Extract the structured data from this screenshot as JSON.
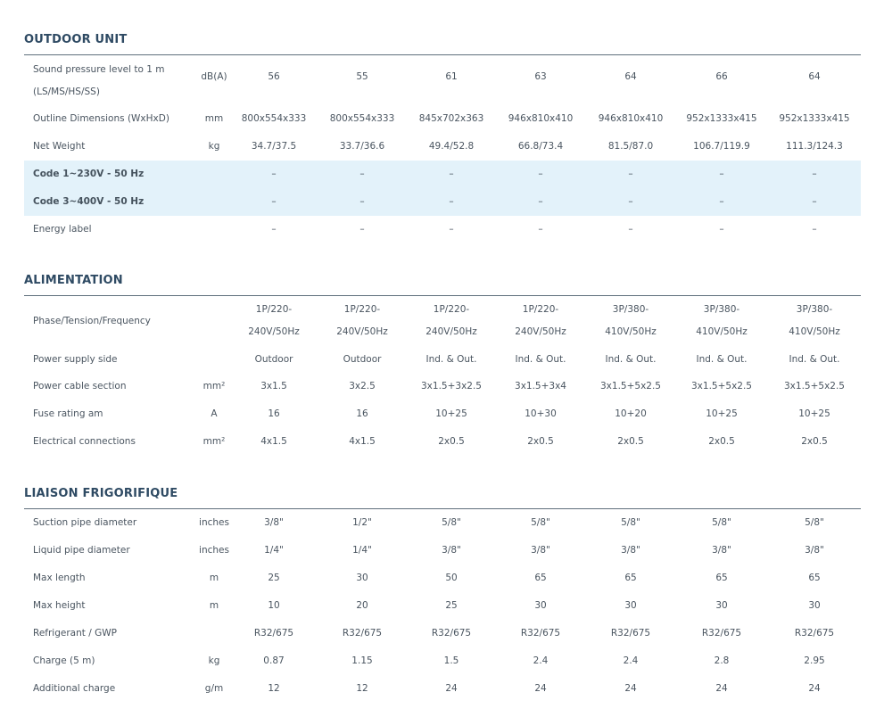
{
  "sections": [
    {
      "title": "OUTDOOR UNIT",
      "rows": [
        {
          "label": "Sound pressure level to 1 m (LS/MS/HS/SS)",
          "unit": "dB(A)",
          "values": [
            "56",
            "55",
            "61",
            "63",
            "64",
            "66",
            "64"
          ]
        },
        {
          "label": "Outline Dimensions (WxHxD)",
          "unit": "mm",
          "values": [
            "800x554x333",
            "800x554x333",
            "845x702x363",
            "946x810x410",
            "946x810x410",
            "952x1333x415",
            "952x1333x415"
          ]
        },
        {
          "label": "Net Weight",
          "unit": "kg",
          "values": [
            "34.7/37.5",
            "33.7/36.6",
            "49.4/52.8",
            "66.8/73.4",
            "81.5/87.0",
            "106.7/119.9",
            "111.3/124.3"
          ]
        },
        {
          "label": "Code 1~230V - 50 Hz",
          "unit": "",
          "values": [
            "–",
            "–",
            "–",
            "–",
            "–",
            "–",
            "–"
          ],
          "highlight": true
        },
        {
          "label": "Code 3~400V - 50 Hz",
          "unit": "",
          "values": [
            "–",
            "–",
            "–",
            "–",
            "–",
            "–",
            "–"
          ],
          "highlight": true
        },
        {
          "label": "Energy label",
          "unit": "",
          "values": [
            "–",
            "–",
            "–",
            "–",
            "–",
            "–",
            "–"
          ]
        }
      ]
    },
    {
      "title": "ALIMENTATION",
      "rows": [
        {
          "label": "Phase/Tension/Frequency",
          "unit": "",
          "values": [
            "1P/220-240V/50Hz",
            "1P/220-240V/50Hz",
            "1P/220-240V/50Hz",
            "1P/220-240V/50Hz",
            "3P/380-410V/50Hz",
            "3P/380-410V/50Hz",
            "3P/380-410V/50Hz"
          ]
        },
        {
          "label": "Power supply side",
          "unit": "",
          "values": [
            "Outdoor",
            "Outdoor",
            "Ind. & Out.",
            "Ind. & Out.",
            "Ind. & Out.",
            "Ind. & Out.",
            "Ind. & Out."
          ]
        },
        {
          "label": "Power cable section",
          "unit": "mm²",
          "values": [
            "3x1.5",
            "3x2.5",
            "3x1.5+3x2.5",
            "3x1.5+3x4",
            "3x1.5+5x2.5",
            "3x1.5+5x2.5",
            "3x1.5+5x2.5"
          ]
        },
        {
          "label": "Fuse rating am",
          "unit": "A",
          "values": [
            "16",
            "16",
            "10+25",
            "10+30",
            "10+20",
            "10+25",
            "10+25"
          ]
        },
        {
          "label": "Electrical connections",
          "unit": "mm²",
          "values": [
            "4x1.5",
            "4x1.5",
            "2x0.5",
            "2x0.5",
            "2x0.5",
            "2x0.5",
            "2x0.5"
          ]
        }
      ]
    },
    {
      "title": "LIAISON FRIGORIFIQUE",
      "rows": [
        {
          "label": "Suction pipe diameter",
          "unit": "inches",
          "values": [
            "3/8\"",
            "1/2\"",
            "5/8\"",
            "5/8\"",
            "5/8\"",
            "5/8\"",
            "5/8\""
          ]
        },
        {
          "label": "Liquid pipe diameter",
          "unit": "inches",
          "values": [
            "1/4\"",
            "1/4\"",
            "3/8\"",
            "3/8\"",
            "3/8\"",
            "3/8\"",
            "3/8\""
          ]
        },
        {
          "label": "Max length",
          "unit": "m",
          "values": [
            "25",
            "30",
            "50",
            "65",
            "65",
            "65",
            "65"
          ]
        },
        {
          "label": "Max height",
          "unit": "m",
          "values": [
            "10",
            "20",
            "25",
            "30",
            "30",
            "30",
            "30"
          ]
        },
        {
          "label": "Refrigerant / GWP",
          "unit": "",
          "values": [
            "R32/675",
            "R32/675",
            "R32/675",
            "R32/675",
            "R32/675",
            "R32/675",
            "R32/675"
          ]
        },
        {
          "label": "Charge (5 m)",
          "unit": "kg",
          "values": [
            "0.87",
            "1.15",
            "1.5",
            "2.4",
            "2.4",
            "2.8",
            "2.95"
          ]
        },
        {
          "label": "Additional charge",
          "unit": "g/m",
          "values": [
            "12",
            "12",
            "24",
            "24",
            "24",
            "24",
            "24"
          ]
        }
      ]
    }
  ]
}
